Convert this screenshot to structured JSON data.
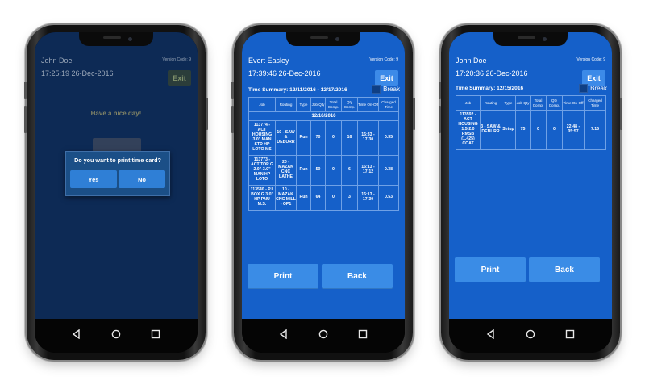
{
  "phones": [
    {
      "user_name": "John Doe",
      "datetime": "17:25:19  26-Dec-2016",
      "version_code": "Version Code: 9",
      "exit_label": "Exit",
      "message": "Have a nice day!",
      "continue_label": "Continue",
      "dialog": {
        "question": "Do you want to print time card?",
        "yes_label": "Yes",
        "no_label": "No"
      }
    },
    {
      "user_name": "Evert Easley",
      "datetime": "17:39:46  26-Dec-2016",
      "version_code": "Version Code: 9",
      "exit_label": "Exit",
      "summary_label": "Time Summary: 12/11/2016 - 12/17/2016",
      "break_label": "Break",
      "table": {
        "headers": [
          "Job",
          "Routing",
          "Type",
          "Job Qty",
          "Total Comp.",
          "Qty Comp.",
          "Time On-Off",
          "Charged Time"
        ],
        "date": "12/16/2016",
        "rows": [
          [
            "113774 - ACT HOUSING 3.0\" MAN STD HP LOTO MS",
            "10 - SAW & DEBURR",
            "Run",
            "70",
            "0",
            "16",
            "16:33 - 17:30",
            "0.35"
          ],
          [
            "113773 - ACT TOP G 2.0\"-3.0\" MAN HP LOTO",
            "20 - MAZAK CNC LATHE",
            "Run",
            "50",
            "0",
            "6",
            "16:13 - 17:12",
            "0.38"
          ],
          [
            "113540 - P.I. BOX G 3.0\" HP PNU M.S.",
            "10 - MAZAK CNC MILL - OP1",
            "Run",
            "64",
            "0",
            "3",
            "16:13 - 17:30",
            "0.53"
          ]
        ]
      },
      "print_label": "Print",
      "back_label": "Back"
    },
    {
      "user_name": "John Doe",
      "datetime": "17:20:36  26-Dec-2016",
      "version_code": "Version Code: 9",
      "exit_label": "Exit",
      "summary_label": "Time Summary: 12/15/2016",
      "break_label": "Break",
      "table": {
        "headers": [
          "Job",
          "Routing",
          "Type",
          "Job Qty",
          "Total Comp.",
          "Qty Comp.",
          "Time On-Off",
          "Charged Time"
        ],
        "rows": [
          [
            "113592 - ACT HOUSING 1.5-2.0 RMSB (1.425) COAT",
            "3 - SAW & DEBURR",
            "Setup",
            "75",
            "0",
            "0",
            "22:48 - 05:57",
            "7.15"
          ]
        ]
      },
      "print_label": "Print",
      "back_label": "Back"
    }
  ],
  "colors": {
    "app_blue": "#1560c9",
    "button_blue": "#3a8ce6",
    "dim_navy": "#0d2a55"
  },
  "nav_icons": [
    "back-icon",
    "home-icon",
    "recent-apps-icon"
  ]
}
